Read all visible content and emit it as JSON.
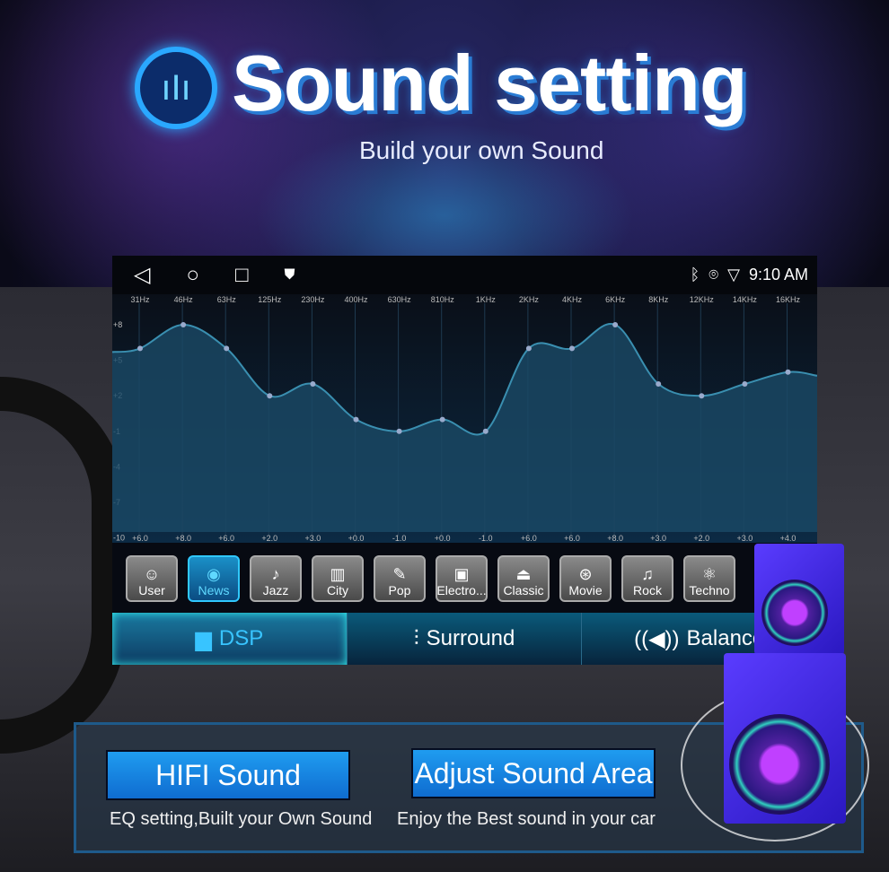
{
  "header": {
    "title": "Sound setting",
    "subtitle": "Build your own Sound",
    "logo_icon": "equalizer-icon"
  },
  "status_bar": {
    "time": "9:10 AM",
    "icons": [
      "bluetooth-icon",
      "location-icon",
      "wifi-icon"
    ],
    "nav": [
      "back-icon",
      "home-icon",
      "recents-icon",
      "shield-icon"
    ]
  },
  "chart_data": {
    "type": "line",
    "categories": [
      "31Hz",
      "46Hz",
      "63Hz",
      "125Hz",
      "230Hz",
      "400Hz",
      "630Hz",
      "810Hz",
      "1KHz",
      "2KHz",
      "4KHz",
      "6KHz",
      "8KHz",
      "12KHz",
      "14KHz",
      "16KHz"
    ],
    "values": [
      6,
      8,
      6,
      2,
      3,
      0,
      -1,
      0,
      -1,
      6,
      6,
      8,
      3,
      2,
      3,
      4
    ],
    "value_labels": [
      "+6.0",
      "+8.0",
      "+6.0",
      "+2.0",
      "+3.0",
      "+0.0",
      "-1.0",
      "+0.0",
      "-1.0",
      "+6.0",
      "+6.0",
      "+8.0",
      "+3.0",
      "+2.0",
      "+3.0",
      "+4.0"
    ],
    "yticks": [
      "+8",
      "+5",
      "+2",
      "-1",
      "-4",
      "-7",
      "-10"
    ],
    "ylim": [
      -10,
      10
    ],
    "grid": true,
    "color": "#3a8fb0"
  },
  "presets": [
    {
      "label": "User",
      "icon": "user-icon"
    },
    {
      "label": "News",
      "icon": "news-icon",
      "active": true
    },
    {
      "label": "Jazz",
      "icon": "saxophone-icon"
    },
    {
      "label": "City",
      "icon": "building-icon"
    },
    {
      "label": "Pop",
      "icon": "microphone-icon"
    },
    {
      "label": "Electro...",
      "icon": "chip-icon"
    },
    {
      "label": "Classic",
      "icon": "gramophone-icon"
    },
    {
      "label": "Movie",
      "icon": "film-reel-icon"
    },
    {
      "label": "Rock",
      "icon": "guitar-icon"
    },
    {
      "label": "Techno",
      "icon": "atom-icon"
    }
  ],
  "tabs": [
    {
      "label": "DSP",
      "icon": "equalizer-bars-icon"
    },
    {
      "label": "Surround",
      "icon": "sliders-icon"
    },
    {
      "label": "Balance",
      "icon": "speaker-icon"
    }
  ],
  "features": [
    {
      "button": "HIFI Sound",
      "caption": "EQ setting,Built your Own Sound"
    },
    {
      "button": "Adjust Sound Area",
      "caption": "Enjoy the Best sound in your car"
    }
  ],
  "colors": {
    "accent": "#1f9cf0",
    "active_tab": "#38c4ff"
  }
}
